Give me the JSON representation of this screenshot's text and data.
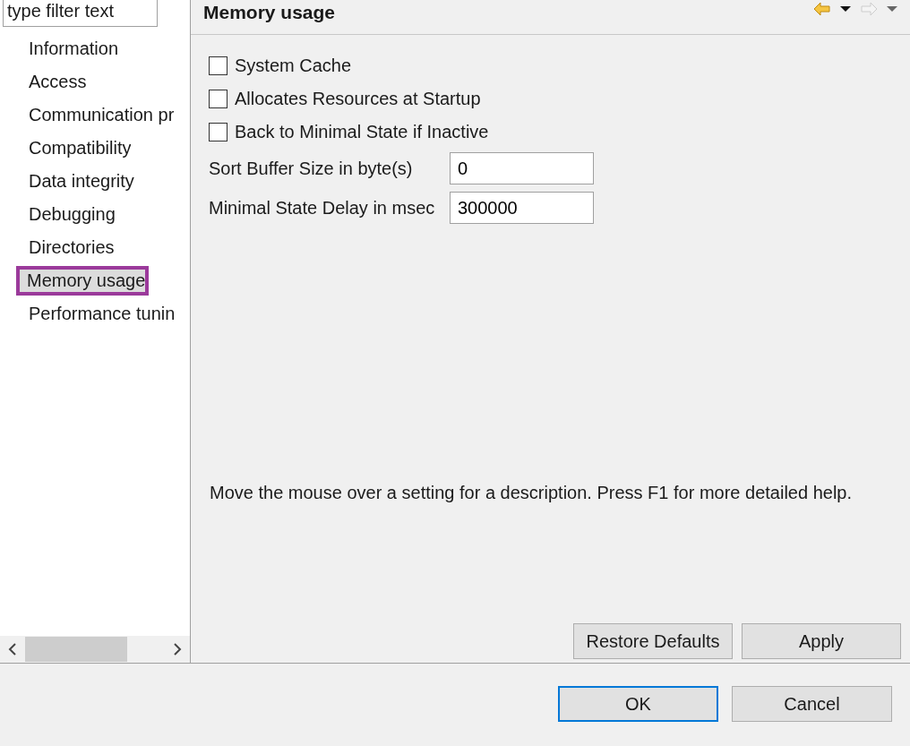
{
  "filter": {
    "placeholder": "type filter text"
  },
  "sidebar": {
    "items": [
      {
        "label": "Information",
        "selected": false
      },
      {
        "label": "Access",
        "selected": false
      },
      {
        "label": "Communication pr",
        "selected": false
      },
      {
        "label": "Compatibility",
        "selected": false
      },
      {
        "label": "Data integrity",
        "selected": false
      },
      {
        "label": "Debugging",
        "selected": false
      },
      {
        "label": "Directories",
        "selected": false
      },
      {
        "label": "Memory usage",
        "selected": true
      },
      {
        "label": "Performance tunin",
        "selected": false
      }
    ]
  },
  "page": {
    "title": "Memory usage",
    "nav": {
      "back_disabled": false,
      "forward_disabled": true
    },
    "checkboxes": [
      {
        "label": "System Cache",
        "checked": false
      },
      {
        "label": "Allocates Resources at Startup",
        "checked": false
      },
      {
        "label": "Back to Minimal State if Inactive",
        "checked": false
      }
    ],
    "fields": [
      {
        "label": "Sort Buffer Size in byte(s)",
        "value": "0"
      },
      {
        "label": "Minimal State Delay in msec",
        "value": "300000"
      }
    ],
    "help": "Move the mouse over a setting for a description. Press F1 for more detailed help.",
    "buttons": [
      "Restore Defaults",
      "Apply"
    ]
  },
  "dialog_buttons": [
    {
      "label": "OK",
      "default": true
    },
    {
      "label": "Cancel",
      "default": false
    }
  ]
}
